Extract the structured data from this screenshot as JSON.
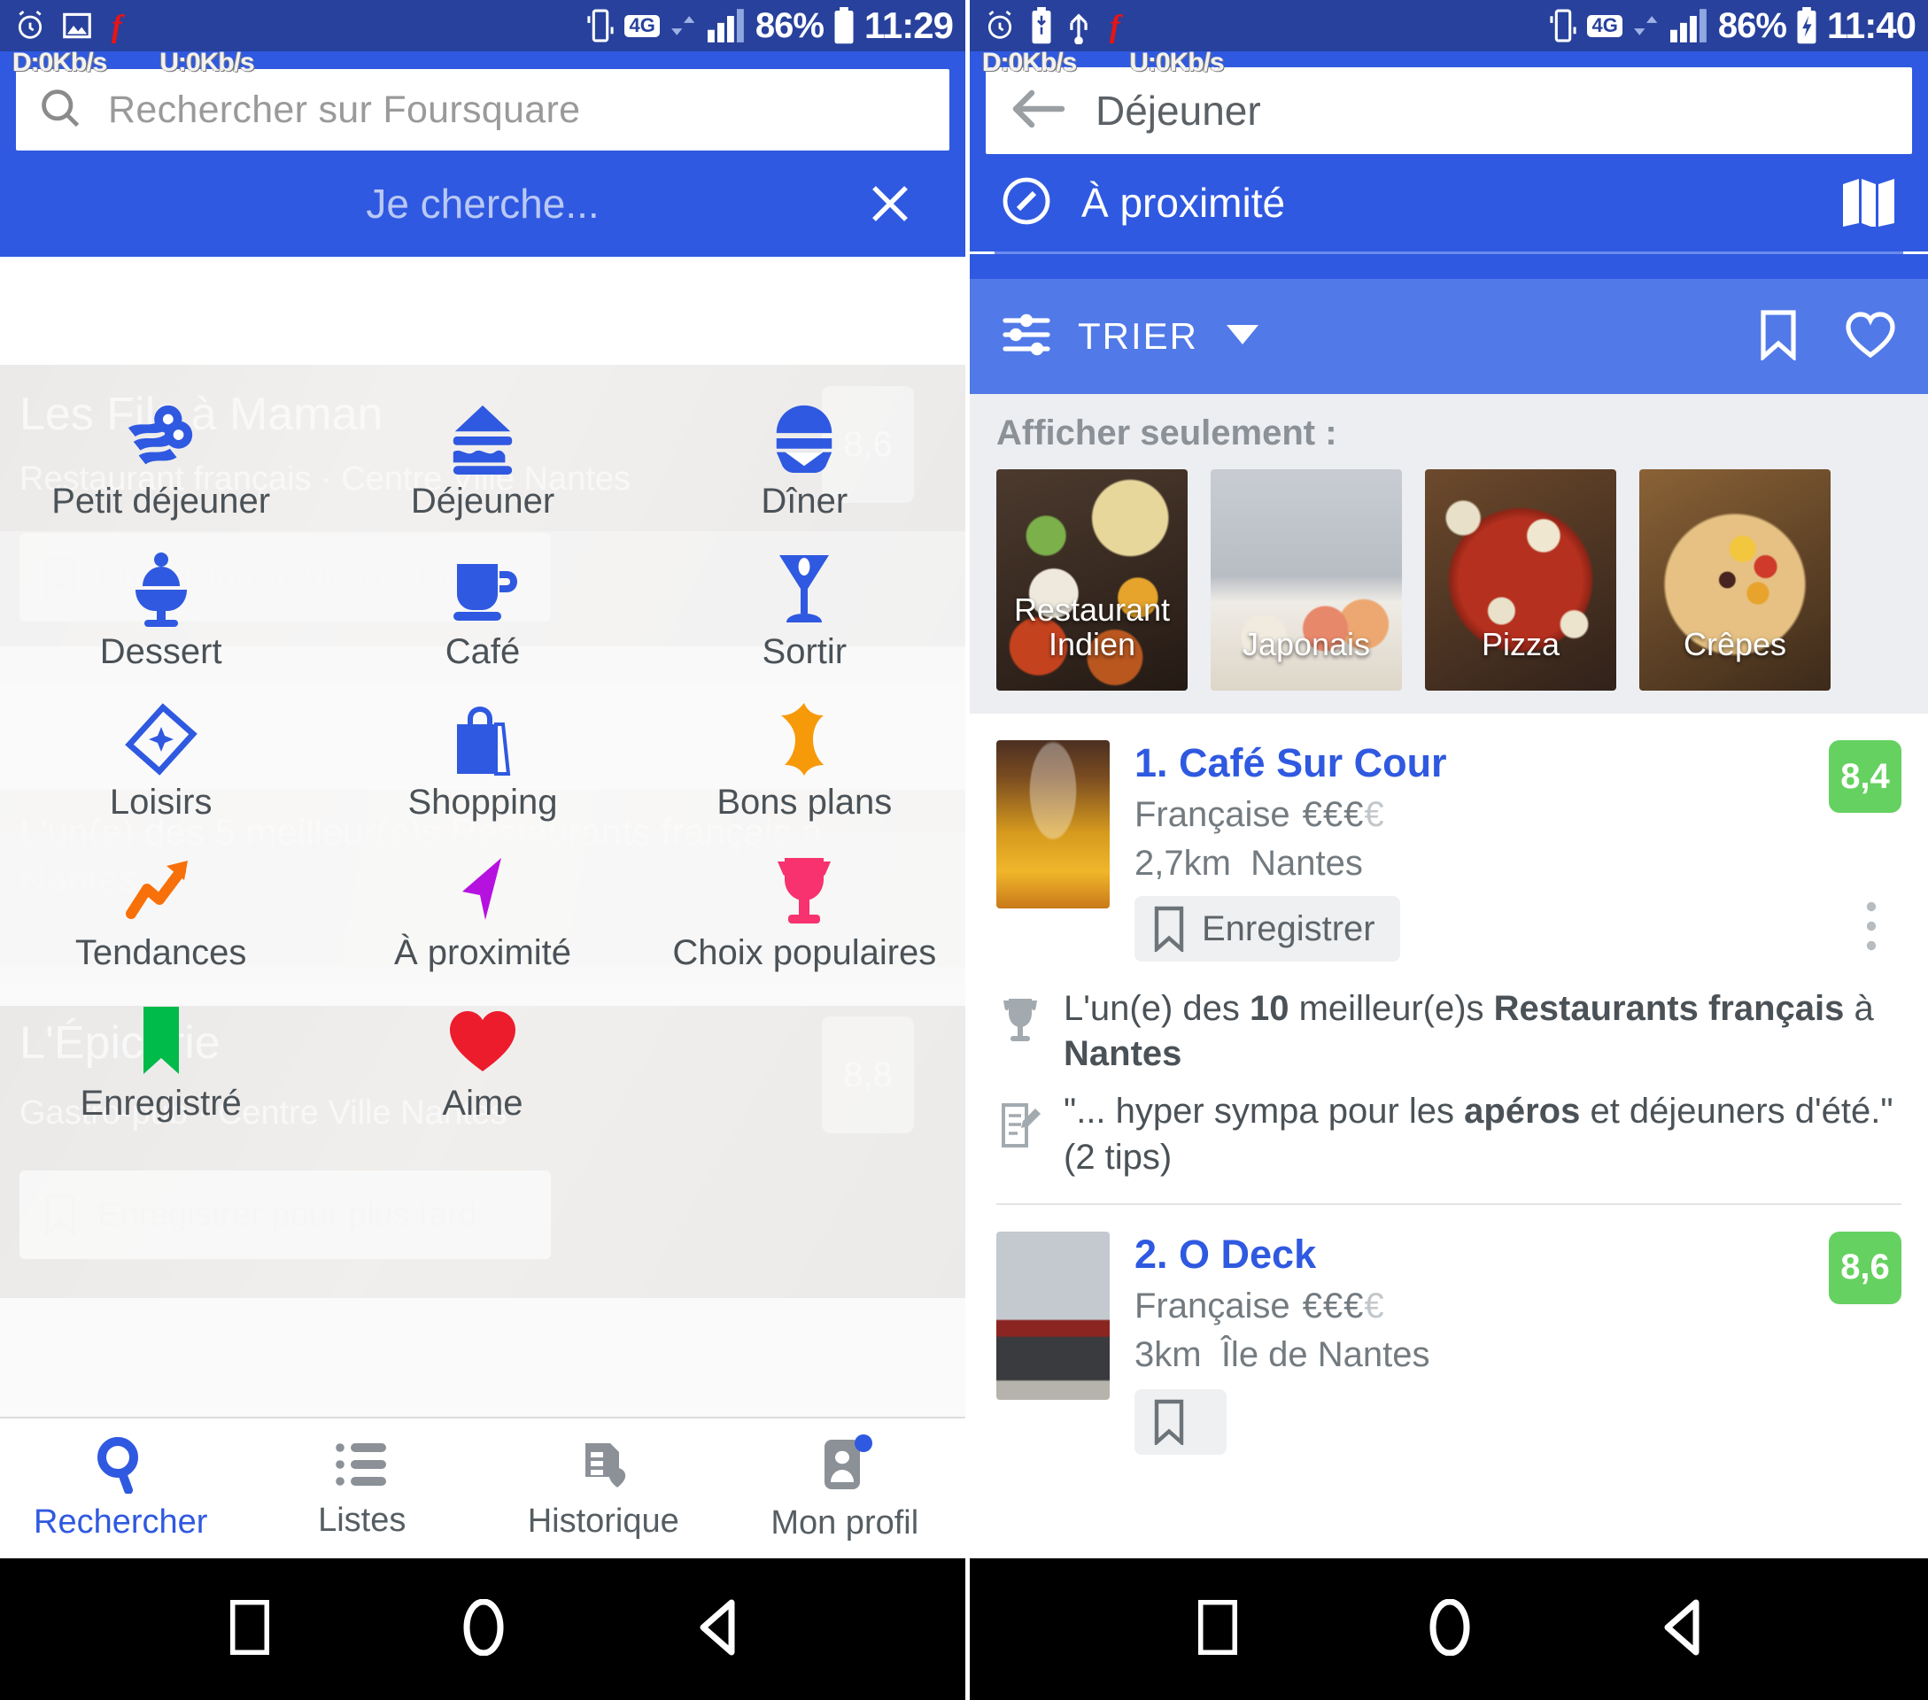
{
  "left": {
    "status": {
      "battery": "86%",
      "time": "11:29",
      "network_4g": "4G"
    },
    "netspeed": {
      "down": "D:0Kb/s",
      "up": "U:0Kb/s"
    },
    "search": {
      "placeholder": "Rechercher sur Foursquare"
    },
    "overlay": {
      "title": "Je cherche...",
      "close": "✕"
    },
    "categories": [
      {
        "label": "Petit déjeuner",
        "icon": "bacon-eggs-icon",
        "color": "#2f59e0"
      },
      {
        "label": "Déjeuner",
        "icon": "sandwich-icon",
        "color": "#2f59e0"
      },
      {
        "label": "Dîner",
        "icon": "burger-icon",
        "color": "#2f59e0"
      },
      {
        "label": "Dessert",
        "icon": "ice-cream-cup-icon",
        "color": "#2f59e0"
      },
      {
        "label": "Café",
        "icon": "coffee-cup-icon",
        "color": "#2f59e0"
      },
      {
        "label": "Sortir",
        "icon": "cocktail-glass-icon",
        "color": "#2f59e0"
      },
      {
        "label": "Loisirs",
        "icon": "ticket-icon",
        "color": "#2f59e0"
      },
      {
        "label": "Shopping",
        "icon": "shopping-bag-icon",
        "color": "#2f59e0"
      },
      {
        "label": "Bons plans",
        "icon": "starburst-deal-icon",
        "color": "#f79a09"
      },
      {
        "label": "Tendances",
        "icon": "trending-arrow-icon",
        "color": "#f7700a"
      },
      {
        "label": "À proximité",
        "icon": "navigation-arrow-icon",
        "color": "#b512e0"
      },
      {
        "label": "Choix populaires",
        "icon": "trophy-icon",
        "color": "#f7326e"
      },
      {
        "label": "Enregistré",
        "icon": "bookmark-icon",
        "color": "#00ba4a"
      },
      {
        "label": "Aime",
        "icon": "heart-icon",
        "color": "#ec1c2d"
      }
    ],
    "background_cards": [
      {
        "title": "Les Fils à Maman",
        "subtitle": "Restaurant français · Centre Ville Nantes",
        "save": "Enregistrer pour plus tard",
        "score": "8,6"
      },
      {
        "title": "",
        "subtitle": "L'un(e) des 5 meilleur(e)s Restaurants français à Nantes",
        "save": "",
        "score": ""
      },
      {
        "title": "L'Épicerie",
        "subtitle": "Gastro-pub · Centre Ville Nantes",
        "save": "Enregistrer pour plus tard",
        "score": "8,8"
      }
    ],
    "tabs": [
      {
        "label": "Rechercher",
        "icon": "search-icon",
        "active": true
      },
      {
        "label": "Listes",
        "icon": "list-icon",
        "active": false
      },
      {
        "label": "Historique",
        "icon": "history-icon",
        "active": false
      },
      {
        "label": "Mon profil",
        "icon": "profile-icon",
        "active": false
      }
    ]
  },
  "right": {
    "status": {
      "battery": "86%",
      "time": "11:40",
      "network_4g": "4G"
    },
    "netspeed": {
      "down": "D:0Kb/s",
      "up": "U:0Kb/s"
    },
    "search": {
      "value": "Déjeuner",
      "back_icon": "back-arrow-icon"
    },
    "proximity": {
      "label": "À proximité",
      "icon": "compass-icon",
      "map_icon": "map-icon"
    },
    "sortbar": {
      "label": "TRIER",
      "icon": "sliders-icon",
      "caret": "▼",
      "bookmark_icon": "bookmark-outline-icon",
      "heart_icon": "heart-outline-icon"
    },
    "filters": {
      "title": "Afficher seulement :",
      "items": [
        {
          "label": "Restaurant Indien",
          "image": "indian-food-photo"
        },
        {
          "label": "Japonais",
          "image": "sushi-photo"
        },
        {
          "label": "Pizza",
          "image": "pizza-photo"
        },
        {
          "label": "Crêpes",
          "image": "crepe-photo"
        }
      ]
    },
    "results": [
      {
        "name": "1. Café Sur Cour",
        "cuisine": "Française",
        "price_on": "€€€",
        "price_off": "€",
        "distance": "2,7km",
        "area": "Nantes",
        "save_label": "Enregistrer",
        "score": "8,4",
        "facts": [
          {
            "icon": "trophy-icon",
            "pre": "L'un(e) des ",
            "b1": "10",
            "mid": " meilleur(e)s ",
            "b2": "Restaurants français",
            "post": " à ",
            "b3": "Nantes",
            "tail": ""
          },
          {
            "icon": "tip-note-icon",
            "pre": "\"... hyper sympa pour les ",
            "b1": "apéros",
            "mid": " et déjeuners d'été.\" (2 tips)",
            "b2": "",
            "post": "",
            "b3": "",
            "tail": ""
          }
        ]
      },
      {
        "name": "2. O Deck",
        "cuisine": "Française",
        "price_on": "€€€",
        "price_off": "€",
        "distance": "3km",
        "area": "Île de Nantes",
        "save_label": "",
        "score": "8,6",
        "facts": []
      }
    ]
  },
  "sysnav": {
    "recent": "square-icon",
    "home": "circle-icon",
    "back": "triangle-back-icon"
  }
}
